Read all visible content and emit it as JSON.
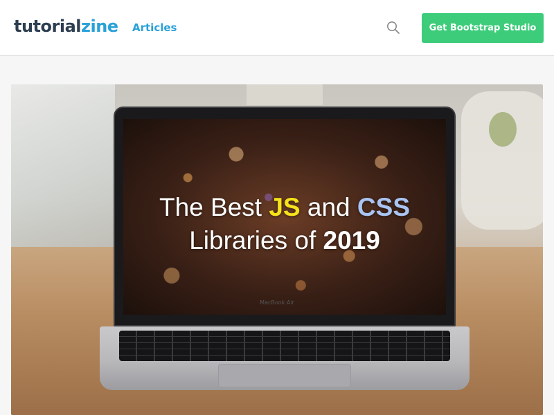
{
  "header": {
    "logo_part1": "tutorial",
    "logo_part2": "zine",
    "nav_articles": "Articles",
    "search_icon": "search-icon",
    "cta_label": "Get Bootstrap Studio"
  },
  "hero": {
    "headline_line1_pre": "The Best ",
    "headline_js": "JS",
    "headline_and": " and ",
    "headline_css": "CSS",
    "headline_line2_pre": "Libraries of ",
    "headline_year": "2019",
    "model_label": "MacBook Air"
  },
  "colors": {
    "brand_dark": "#2c3e50",
    "brand_blue": "#2aa1d8",
    "cta_green": "#3ccc7a",
    "js_yellow": "#f5e21a",
    "css_blue": "#a9c4f2"
  }
}
